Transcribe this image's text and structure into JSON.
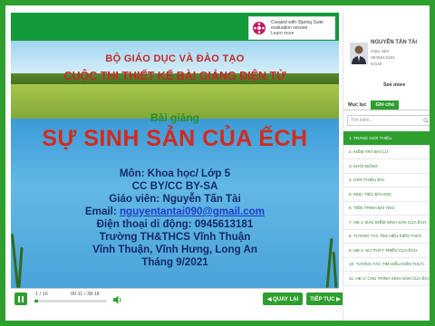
{
  "slide": {
    "ministry": "BỘ GIÁO DỤC VÀ ĐÀO TẠO",
    "contest": "CUỘC THI THIẾT KẾ BÀI GIẢNG ĐIỆN TỬ",
    "lesson_label": "Bài giảng",
    "lesson_title": "SỰ SINH SẢN CỦA ẾCH",
    "subject": "Môn: Khoa học/ Lớp 5",
    "license": "CC BY/CC BY-SA",
    "teacher": "Giáo viên: Nguyễn Tấn Tài",
    "email_label": "Email: ",
    "email": "nguyentantai090@gmail.com",
    "phone": "Điện thoại di động: 0945613181",
    "school": "Trường TH&THCS Vĩnh Thuận",
    "address": "Vĩnh Thuận, Vĩnh Hưng, Long An",
    "date": "Tháng 9/2021"
  },
  "watermark": {
    "line1": "Created with iSpring Suite",
    "line2": "evaluation version",
    "line3": "Learn more"
  },
  "player": {
    "slide_counter": "1 / 16",
    "time": "00:11 / 38:18",
    "progress": 0.05,
    "prev_label": "◀ QUAY LẠI",
    "next_label": "TIẾP TỤC ▶"
  },
  "author": {
    "name": "NGUYỄN TẤN TÀI",
    "role": "Giáo viên",
    "phone": "0945613181",
    "email": "Email",
    "see_more": "See more"
  },
  "tabs": {
    "outline": "Mục lục",
    "notes": "Ghi chú"
  },
  "search": {
    "placeholder": "Tìm kiếm..."
  },
  "menu": [
    "1. TRANG GIỚI THIỆU",
    "2. KIỂM TRA BÀI CŨ",
    "3. KHỞI ĐỘNG",
    "4. GIỚI THIỆU BÀI",
    "5. MỤC TIÊU BÀI HỌC",
    "6. TIẾN TRÌNH BÀI HỌC",
    "7. HĐ 1: ĐẶC ĐIỂM SINH SẢN CỦA ẾCH",
    "8. TƯƠNG TÁC TÌM HIỂU KIẾN THỨC",
    "9. HĐ 2: SỰ PHÁT TRIỂN CỦA ẾCH",
    "10. TƯƠNG TÁC TÌM HIỂU KIẾN THỨC",
    "11. HĐ 3: CHU TRÌNH SINH SẢN CỦA ẾCH"
  ],
  "colors": {
    "accent": "#2e9f2e",
    "title_red": "#d42a1c"
  }
}
